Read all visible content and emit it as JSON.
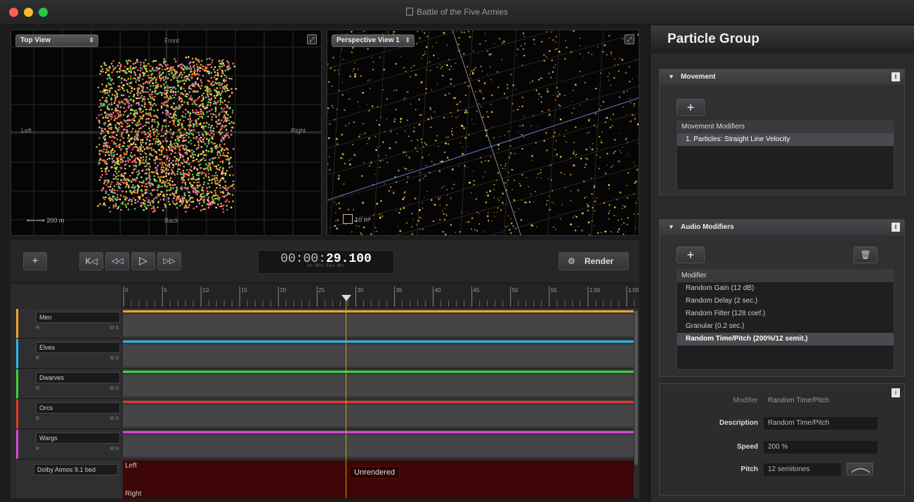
{
  "window": {
    "title": "Battle of the Five Armies",
    "traffic_lights": {
      "close": "#fe5f57",
      "minimize": "#febc2e",
      "zoom": "#28c840"
    }
  },
  "viewport_top": {
    "view_select": "Top View",
    "labels": {
      "front": "Front",
      "back": "Back",
      "left": "Left",
      "right": "Right"
    },
    "scale": "200 m",
    "particle_colors": [
      "#f5a623",
      "#e94c5a",
      "#8fdc4a",
      "#f278c8",
      "#f7e15a",
      "#ff8040",
      "#46d36a"
    ]
  },
  "viewport_perspective": {
    "view_select": "Perspective View 1",
    "scale": "10 m"
  },
  "transport": {
    "add_icon": "+",
    "skip_back_icon": "K◁",
    "rewind_icon": "◁◁",
    "play_icon": "▷",
    "forward_icon": "▷▷",
    "timecode_prefix": "00:00:",
    "timecode_seconds": "29.100",
    "timecode_units": "Hr   Min   Sec   Ms",
    "render_label": "Render"
  },
  "timeline": {
    "ruler_ticks": [
      "0",
      "5",
      "10",
      "15",
      "20",
      "25",
      "30",
      "35",
      "40",
      "45",
      "50",
      "55",
      "1:00",
      "1:05"
    ],
    "tracks": [
      {
        "name": "Men",
        "color": "#f2a52b"
      },
      {
        "name": "Elves",
        "color": "#27b7f5"
      },
      {
        "name": "Dwarves",
        "color": "#38d838"
      },
      {
        "name": "Orcs",
        "color": "#e8382c"
      },
      {
        "name": "Wargs",
        "color": "#d84ad8"
      }
    ],
    "track_controls": {
      "left": "R",
      "mute_solo": "M  S"
    },
    "bed": {
      "name": "Dolby Atmos 9.1 bed",
      "left_label": "Left",
      "right_label": "Right",
      "status": "Unrendered"
    }
  },
  "panel": {
    "title": "Particle Group",
    "movement": {
      "header": "Movement",
      "add_label": "+",
      "list_header": "Movement Modifiers",
      "items": [
        "1. Particles: Straight Line Velocity"
      ]
    },
    "audio_modifiers": {
      "header": "Audio Modifiers",
      "add_label": "+",
      "list_header": "Modifier",
      "items": [
        "Random Gain (12 dB)",
        "Random Delay (2 sec.)",
        "Random Filter (128 coef.)",
        "Granular (0.2 sec.)",
        "Random Time/Pitch (200%/12 semit.)"
      ],
      "selected_index": 4
    },
    "inspector": {
      "modifier_label": "Modifier",
      "modifier_value": "Random Time/Pitch",
      "description_label": "Description",
      "description_value": "Random Time/Pitch",
      "speed_label": "Speed",
      "speed_value": "200 %",
      "pitch_label": "Pitch",
      "pitch_value": "12 semitones"
    }
  }
}
